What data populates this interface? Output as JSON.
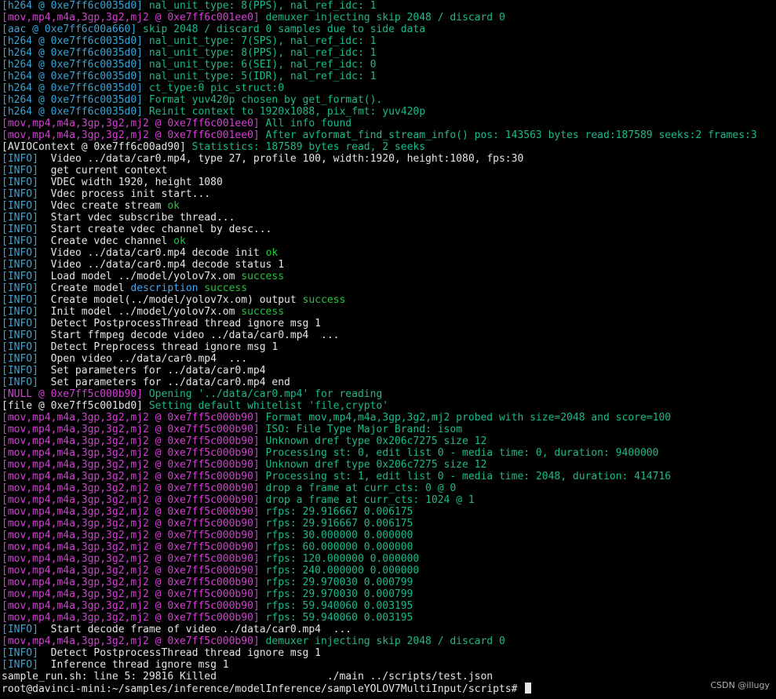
{
  "colors": {
    "background": "#000000",
    "text": "#e6e6e6",
    "cyan": "#37a6d8",
    "green": "#1bba8c",
    "magenta": "#d53fd5",
    "blue": "#4aa3e6",
    "ok": "#27c43f"
  },
  "lines": [
    [
      {
        "t": "[h264 @ 0xe7ff6c0035d0] ",
        "c": "cyan"
      },
      {
        "t": "nal_unit_type: 8(PPS), nal_ref_idc: 1",
        "c": "green"
      }
    ],
    [
      {
        "t": "[mov,mp4,m4a,3gp,3g2,mj2 @ 0xe7ff6c001ee0] ",
        "c": "magenta"
      },
      {
        "t": "demuxer injecting skip 2048 / discard 0",
        "c": "green"
      }
    ],
    [
      {
        "t": "[aac @ 0xe7ff6c00a660] ",
        "c": "cyan"
      },
      {
        "t": "skip 2048 / discard 0 samples due to side data",
        "c": "green"
      }
    ],
    [
      {
        "t": "[h264 @ 0xe7ff6c0035d0] ",
        "c": "cyan"
      },
      {
        "t": "nal_unit_type: 7(SPS), nal_ref_idc: 1",
        "c": "green"
      }
    ],
    [
      {
        "t": "[h264 @ 0xe7ff6c0035d0] ",
        "c": "cyan"
      },
      {
        "t": "nal_unit_type: 8(PPS), nal_ref_idc: 1",
        "c": "green"
      }
    ],
    [
      {
        "t": "[h264 @ 0xe7ff6c0035d0] ",
        "c": "cyan"
      },
      {
        "t": "nal_unit_type: 6(SEI), nal_ref_idc: 0",
        "c": "green"
      }
    ],
    [
      {
        "t": "[h264 @ 0xe7ff6c0035d0] ",
        "c": "cyan"
      },
      {
        "t": "nal_unit_type: 5(IDR), nal_ref_idc: 1",
        "c": "green"
      }
    ],
    [
      {
        "t": "[h264 @ 0xe7ff6c0035d0] ",
        "c": "cyan"
      },
      {
        "t": "ct_type:0 pic_struct:0",
        "c": "green"
      }
    ],
    [
      {
        "t": "[h264 @ 0xe7ff6c0035d0] ",
        "c": "cyan"
      },
      {
        "t": "Format yuv420p chosen by get_format().",
        "c": "green"
      }
    ],
    [
      {
        "t": "[h264 @ 0xe7ff6c0035d0] ",
        "c": "cyan"
      },
      {
        "t": "Reinit context to 1920x1088, pix_fmt: yuv420p",
        "c": "green"
      }
    ],
    [
      {
        "t": "[mov,mp4,m4a,3gp,3g2,mj2 @ 0xe7ff6c001ee0] ",
        "c": "magenta"
      },
      {
        "t": "All info found",
        "c": "green"
      }
    ],
    [
      {
        "t": "[mov,mp4,m4a,3gp,3g2,mj2 @ 0xe7ff6c001ee0] ",
        "c": "magenta"
      },
      {
        "t": "After avformat_find_stream_info() pos: 143563 bytes read:187589 seeks:2 frames:3",
        "c": "green"
      }
    ],
    [
      {
        "t": "[AVIOContext @ 0xe7ff6c00ad90] ",
        "c": "white"
      },
      {
        "t": "Statistics: 187589 bytes read, 2 seeks",
        "c": "green"
      }
    ],
    [
      {
        "t": "[INFO]",
        "c": "cyan"
      },
      {
        "t": "  Video ../data/car0.mp4, type 27, profile 100, width:1920, height:1080, fps:30",
        "c": "plain"
      }
    ],
    [
      {
        "t": "[INFO]",
        "c": "cyan"
      },
      {
        "t": "  get current context",
        "c": "plain"
      }
    ],
    [
      {
        "t": "[INFO]",
        "c": "cyan"
      },
      {
        "t": "  VDEC width 1920, height 1080",
        "c": "plain"
      }
    ],
    [
      {
        "t": "[INFO]",
        "c": "cyan"
      },
      {
        "t": "  Vdec process init start...",
        "c": "plain"
      }
    ],
    [
      {
        "t": "[INFO]",
        "c": "cyan"
      },
      {
        "t": "  Vdec create stream ",
        "c": "plain"
      },
      {
        "t": "ok",
        "c": "ok"
      }
    ],
    [
      {
        "t": "[INFO]",
        "c": "cyan"
      },
      {
        "t": "  Start vdec subscribe thread...",
        "c": "plain"
      }
    ],
    [
      {
        "t": "[INFO]",
        "c": "cyan"
      },
      {
        "t": "  Start create vdec channel by desc...",
        "c": "plain"
      }
    ],
    [
      {
        "t": "[INFO]",
        "c": "cyan"
      },
      {
        "t": "  Create vdec channel ",
        "c": "plain"
      },
      {
        "t": "ok",
        "c": "ok"
      }
    ],
    [
      {
        "t": "[INFO]",
        "c": "cyan"
      },
      {
        "t": "  Video ../data/car0.mp4 decode init ",
        "c": "plain"
      },
      {
        "t": "ok",
        "c": "ok"
      }
    ],
    [
      {
        "t": "[INFO]",
        "c": "cyan"
      },
      {
        "t": "  Video ../data/car0.mp4 decode status 1",
        "c": "plain"
      }
    ],
    [
      {
        "t": "[INFO]",
        "c": "cyan"
      },
      {
        "t": "  Load model ../model/yolov7x.om ",
        "c": "plain"
      },
      {
        "t": "success",
        "c": "ok"
      }
    ],
    [
      {
        "t": "[INFO]",
        "c": "cyan"
      },
      {
        "t": "  Create model ",
        "c": "plain"
      },
      {
        "t": "description",
        "c": "blue"
      },
      {
        "t": " ",
        "c": "plain"
      },
      {
        "t": "success",
        "c": "ok"
      }
    ],
    [
      {
        "t": "[INFO]",
        "c": "cyan"
      },
      {
        "t": "  Create model(../model/yolov7x.om) output ",
        "c": "plain"
      },
      {
        "t": "success",
        "c": "ok"
      }
    ],
    [
      {
        "t": "[INFO]",
        "c": "cyan"
      },
      {
        "t": "  Init model ../model/yolov7x.om ",
        "c": "plain"
      },
      {
        "t": "success",
        "c": "ok"
      }
    ],
    [
      {
        "t": "[INFO]",
        "c": "cyan"
      },
      {
        "t": "  Detect PostprocessThread thread ignore msg 1",
        "c": "plain"
      }
    ],
    [
      {
        "t": "[INFO]",
        "c": "cyan"
      },
      {
        "t": "  Start ffmpeg decode video ../data/car0.mp4  ...",
        "c": "plain"
      }
    ],
    [
      {
        "t": "[INFO]",
        "c": "cyan"
      },
      {
        "t": "  Detect Preprocess thread ignore msg 1",
        "c": "plain"
      }
    ],
    [
      {
        "t": "[INFO]",
        "c": "cyan"
      },
      {
        "t": "  Open video ../data/car0.mp4  ...",
        "c": "plain"
      }
    ],
    [
      {
        "t": "[INFO]",
        "c": "cyan"
      },
      {
        "t": "  Set parameters for ../data/car0.mp4",
        "c": "plain"
      }
    ],
    [
      {
        "t": "[INFO]",
        "c": "cyan"
      },
      {
        "t": "  Set parameters for ../data/car0.mp4 end",
        "c": "plain"
      }
    ],
    [
      {
        "t": "[NULL @ 0xe7ff5c000b90] ",
        "c": "magenta"
      },
      {
        "t": "Opening '../data/car0.mp4' for reading",
        "c": "green"
      }
    ],
    [
      {
        "t": "[file @ 0xe7ff5c001bd0] ",
        "c": "white"
      },
      {
        "t": "Setting default whitelist 'file,crypto'",
        "c": "green"
      }
    ],
    [
      {
        "t": "[mov,mp4,m4a,3gp,3g2,mj2 @ 0xe7ff5c000b90] ",
        "c": "magenta"
      },
      {
        "t": "Format mov,mp4,m4a,3gp,3g2,mj2 probed with size=2048 and score=100",
        "c": "green"
      }
    ],
    [
      {
        "t": "[mov,mp4,m4a,3gp,3g2,mj2 @ 0xe7ff5c000b90] ",
        "c": "magenta"
      },
      {
        "t": "ISO: File Type Major Brand: isom",
        "c": "green"
      }
    ],
    [
      {
        "t": "[mov,mp4,m4a,3gp,3g2,mj2 @ 0xe7ff5c000b90] ",
        "c": "magenta"
      },
      {
        "t": "Unknown dref type 0x206c7275 size 12",
        "c": "green"
      }
    ],
    [
      {
        "t": "[mov,mp4,m4a,3gp,3g2,mj2 @ 0xe7ff5c000b90] ",
        "c": "magenta"
      },
      {
        "t": "Processing st: 0, edit list 0 - media time: 0, duration: 9400000",
        "c": "green"
      }
    ],
    [
      {
        "t": "[mov,mp4,m4a,3gp,3g2,mj2 @ 0xe7ff5c000b90] ",
        "c": "magenta"
      },
      {
        "t": "Unknown dref type 0x206c7275 size 12",
        "c": "green"
      }
    ],
    [
      {
        "t": "[mov,mp4,m4a,3gp,3g2,mj2 @ 0xe7ff5c000b90] ",
        "c": "magenta"
      },
      {
        "t": "Processing st: 1, edit list 0 - media time: 2048, duration: 414716",
        "c": "green"
      }
    ],
    [
      {
        "t": "[mov,mp4,m4a,3gp,3g2,mj2 @ 0xe7ff5c000b90] ",
        "c": "magenta"
      },
      {
        "t": "drop a frame at curr_cts: 0 @ 0",
        "c": "green"
      }
    ],
    [
      {
        "t": "[mov,mp4,m4a,3gp,3g2,mj2 @ 0xe7ff5c000b90] ",
        "c": "magenta"
      },
      {
        "t": "drop a frame at curr_cts: 1024 @ 1",
        "c": "green"
      }
    ],
    [
      {
        "t": "[mov,mp4,m4a,3gp,3g2,mj2 @ 0xe7ff5c000b90] ",
        "c": "magenta"
      },
      {
        "t": "rfps: 29.916667 0.006175",
        "c": "green"
      }
    ],
    [
      {
        "t": "[mov,mp4,m4a,3gp,3g2,mj2 @ 0xe7ff5c000b90] ",
        "c": "magenta"
      },
      {
        "t": "rfps: 29.916667 0.006175",
        "c": "green"
      }
    ],
    [
      {
        "t": "[mov,mp4,m4a,3gp,3g2,mj2 @ 0xe7ff5c000b90] ",
        "c": "magenta"
      },
      {
        "t": "rfps: 30.000000 0.000000",
        "c": "green"
      }
    ],
    [
      {
        "t": "[mov,mp4,m4a,3gp,3g2,mj2 @ 0xe7ff5c000b90] ",
        "c": "magenta"
      },
      {
        "t": "rfps: 60.000000 0.000000",
        "c": "green"
      }
    ],
    [
      {
        "t": "[mov,mp4,m4a,3gp,3g2,mj2 @ 0xe7ff5c000b90] ",
        "c": "magenta"
      },
      {
        "t": "rfps: 120.000000 0.000000",
        "c": "green"
      }
    ],
    [
      {
        "t": "[mov,mp4,m4a,3gp,3g2,mj2 @ 0xe7ff5c000b90] ",
        "c": "magenta"
      },
      {
        "t": "rfps: 240.000000 0.000000",
        "c": "green"
      }
    ],
    [
      {
        "t": "[mov,mp4,m4a,3gp,3g2,mj2 @ 0xe7ff5c000b90] ",
        "c": "magenta"
      },
      {
        "t": "rfps: 29.970030 0.000799",
        "c": "green"
      }
    ],
    [
      {
        "t": "[mov,mp4,m4a,3gp,3g2,mj2 @ 0xe7ff5c000b90] ",
        "c": "magenta"
      },
      {
        "t": "rfps: 29.970030 0.000799",
        "c": "green"
      }
    ],
    [
      {
        "t": "[mov,mp4,m4a,3gp,3g2,mj2 @ 0xe7ff5c000b90] ",
        "c": "magenta"
      },
      {
        "t": "rfps: 59.940060 0.003195",
        "c": "green"
      }
    ],
    [
      {
        "t": "[mov,mp4,m4a,3gp,3g2,mj2 @ 0xe7ff5c000b90] ",
        "c": "magenta"
      },
      {
        "t": "rfps: 59.940060 0.003195",
        "c": "green"
      }
    ],
    [
      {
        "t": "[INFO]",
        "c": "cyan"
      },
      {
        "t": "  Start decode frame of video ../data/car0.mp4  ...",
        "c": "plain"
      }
    ],
    [
      {
        "t": "[mov,mp4,m4a,3gp,3g2,mj2 @ 0xe7ff5c000b90] ",
        "c": "magenta"
      },
      {
        "t": "demuxer injecting skip 2048 / discard 0",
        "c": "green"
      }
    ],
    [
      {
        "t": "[INFO]",
        "c": "cyan"
      },
      {
        "t": "  Detect PostprocessThread thread ignore msg 1",
        "c": "plain"
      }
    ],
    [
      {
        "t": "[INFO]",
        "c": "cyan"
      },
      {
        "t": "  Inference thread ignore msg 1",
        "c": "plain"
      }
    ],
    [
      {
        "t": "sample_run.sh: line 5: 29816 Killed                  ./main ../scripts/test.json",
        "c": "plain"
      }
    ]
  ],
  "prompt": {
    "text": "root@davinci-mini:~/samples/inference/modelInference/sampleYOLOV7MultiInput/scripts# "
  },
  "watermark": {
    "text": "CSDN @illugy"
  }
}
